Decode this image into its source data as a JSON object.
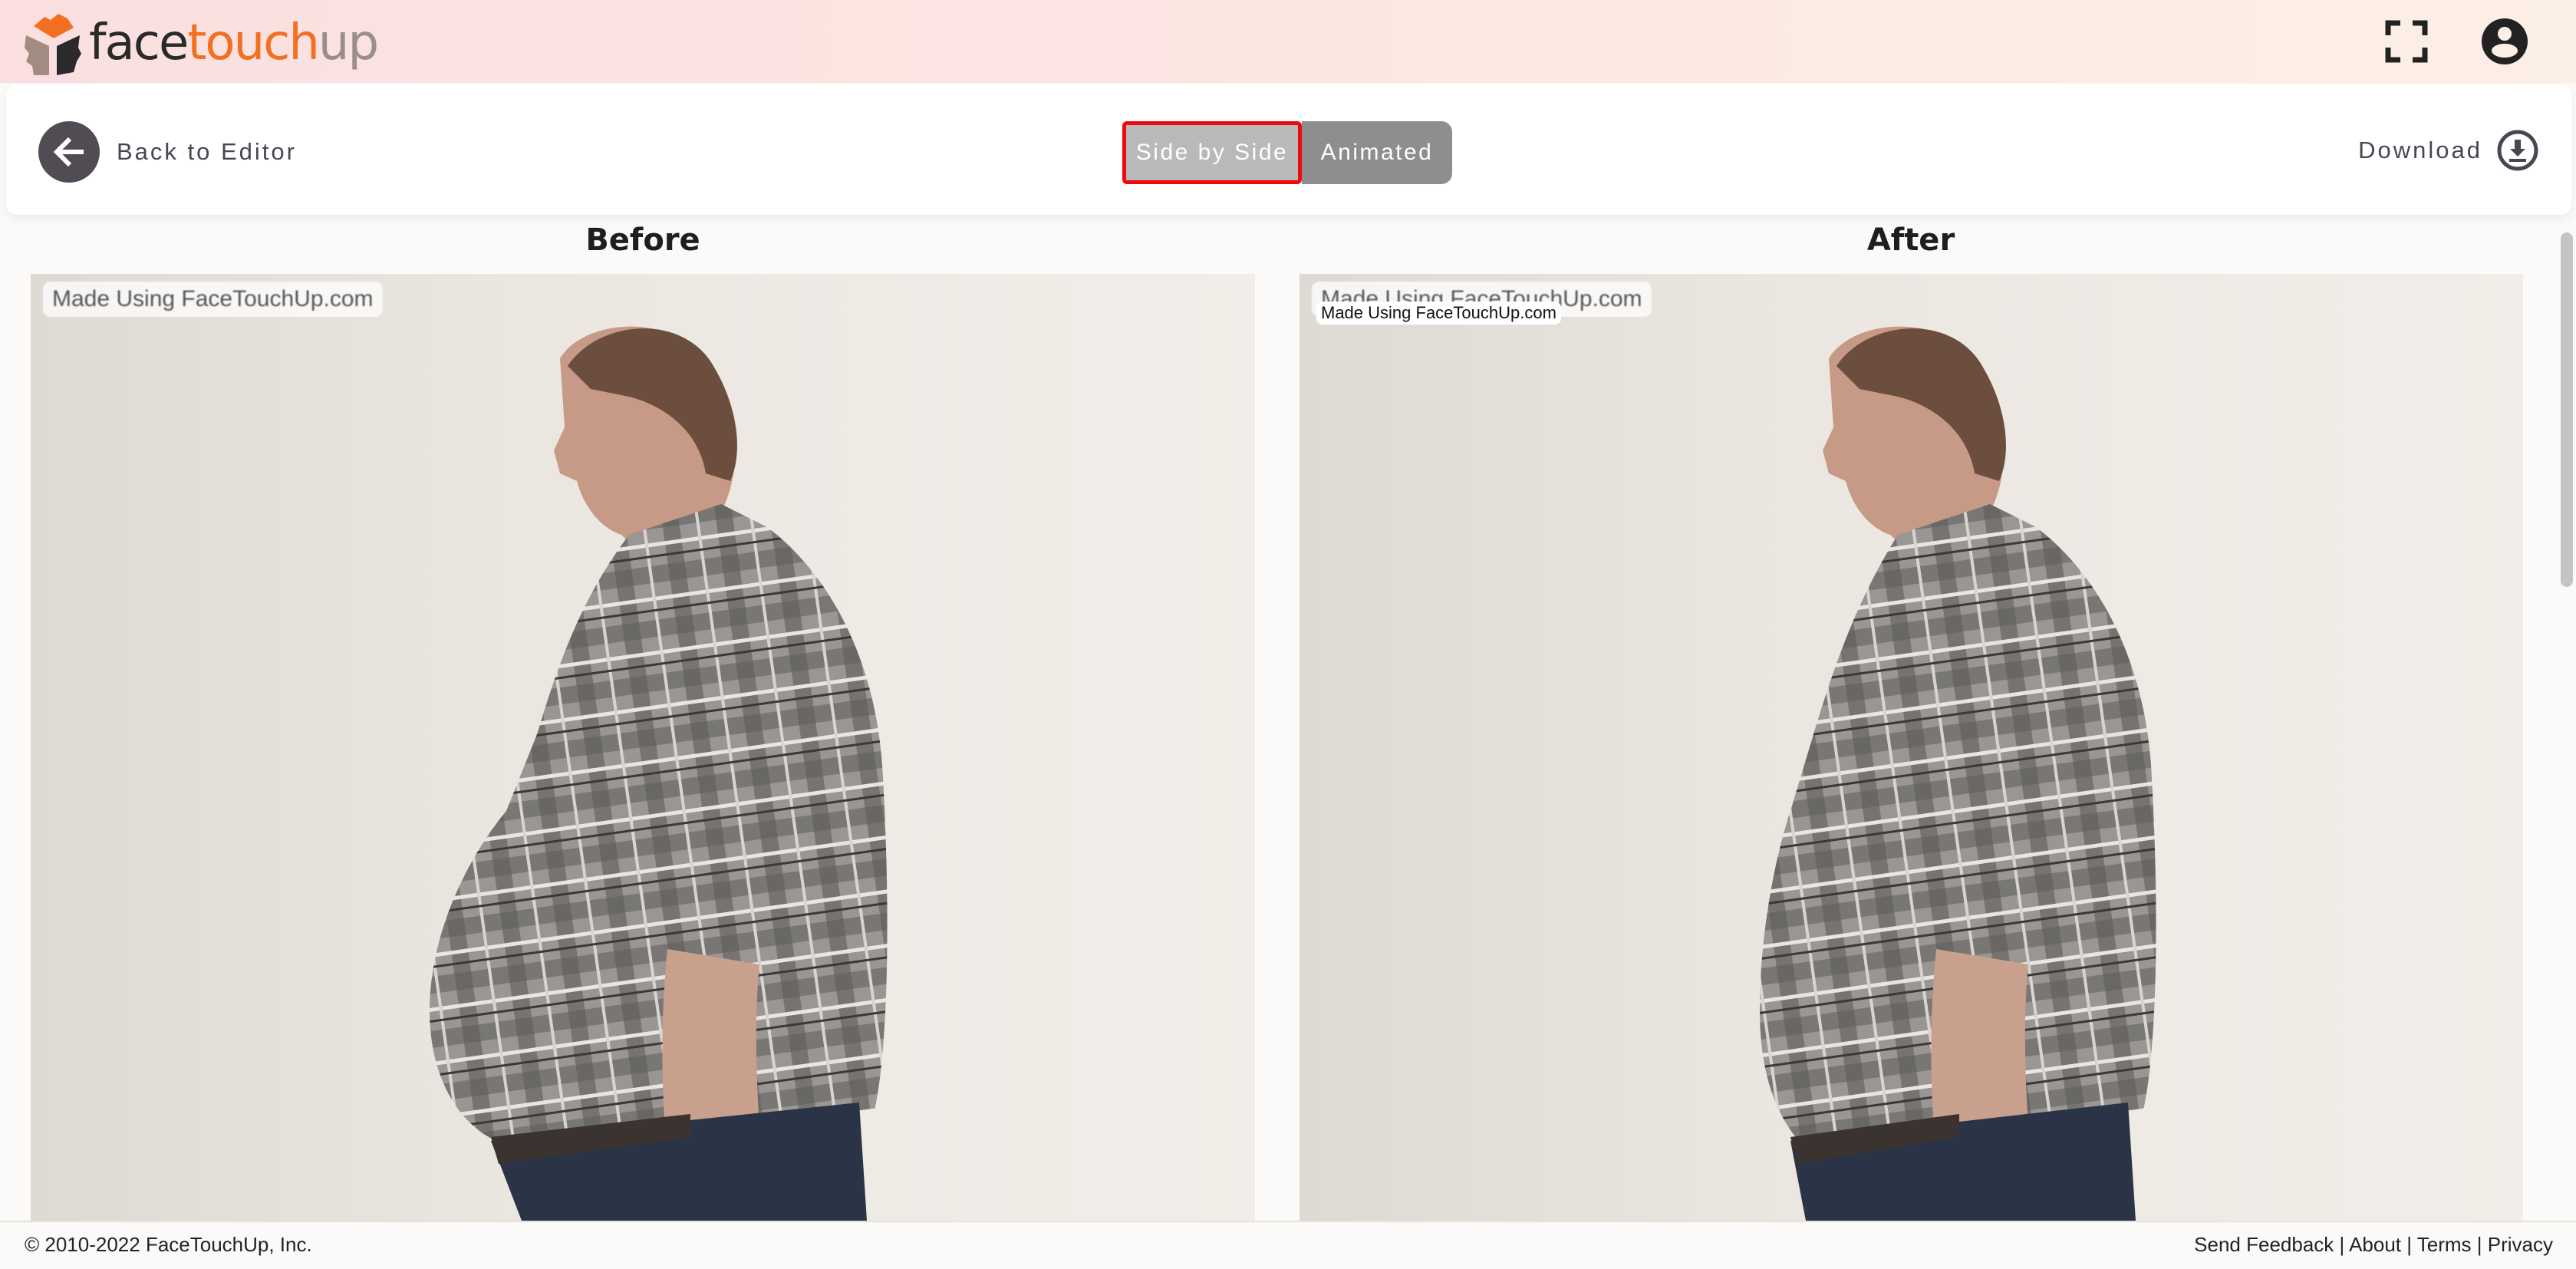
{
  "header": {
    "logo": {
      "part1": "face",
      "part2": "touch",
      "part3": "up"
    },
    "icons": [
      "fullscreen-icon",
      "account-icon"
    ]
  },
  "toolbar": {
    "back_label": "Back to Editor",
    "view_modes": [
      {
        "label": "Side by Side",
        "active": true
      },
      {
        "label": "Animated",
        "active": false
      }
    ],
    "download_label": "Download"
  },
  "comparison": {
    "before": {
      "title": "Before",
      "watermark": "Made Using FaceTouchUp.com"
    },
    "after": {
      "title": "After",
      "watermark": "Made Using FaceTouchUp.com",
      "watermark_overlay": "Made Using FaceTouchUp.com"
    }
  },
  "footer": {
    "copyright": "© 2010-2022 FaceTouchUp, Inc.",
    "links": [
      "Send Feedback",
      "About",
      "Terms",
      "Privacy"
    ],
    "separator": " | "
  },
  "colors": {
    "brand_orange": "#f36f21",
    "active_outline": "#ee0a0a",
    "toggle_inactive": "#8e8e8e",
    "toggle_active": "#b9b9b9"
  }
}
